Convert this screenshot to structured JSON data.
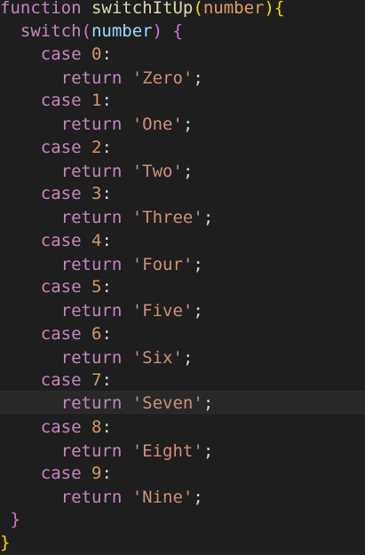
{
  "code": {
    "lines": [
      {
        "indent": "",
        "kw": "function",
        "name": "switchItUp",
        "open": "(",
        "param": "number",
        "close": ")",
        "brace": "{"
      },
      {
        "indent": "  ",
        "kw": "switch",
        "open": "(",
        "param": "number",
        "close": ")",
        "brace": " {"
      },
      {
        "indent": "    ",
        "kw": "case",
        "num": "0",
        "colon": ":"
      },
      {
        "indent": "      ",
        "kw": "return",
        "str": "'Zero'",
        "semi": ";"
      },
      {
        "indent": "    ",
        "kw": "case",
        "num": "1",
        "colon": ":"
      },
      {
        "indent": "      ",
        "kw": "return",
        "str": "'One'",
        "semi": ";"
      },
      {
        "indent": "    ",
        "kw": "case",
        "num": "2",
        "colon": ":"
      },
      {
        "indent": "      ",
        "kw": "return",
        "str": "'Two'",
        "semi": ";"
      },
      {
        "indent": "    ",
        "kw": "case",
        "num": "3",
        "colon": ":"
      },
      {
        "indent": "      ",
        "kw": "return",
        "str": "'Three'",
        "semi": ";"
      },
      {
        "indent": "    ",
        "kw": "case",
        "num": "4",
        "colon": ":"
      },
      {
        "indent": "      ",
        "kw": "return",
        "str": "'Four'",
        "semi": ";"
      },
      {
        "indent": "    ",
        "kw": "case",
        "num": "5",
        "colon": ":"
      },
      {
        "indent": "      ",
        "kw": "return",
        "str": "'Five'",
        "semi": ";"
      },
      {
        "indent": "    ",
        "kw": "case",
        "num": "6",
        "colon": ":"
      },
      {
        "indent": "      ",
        "kw": "return",
        "str": "'Six'",
        "semi": ";"
      },
      {
        "indent": "    ",
        "kw": "case",
        "num": "7",
        "colon": ":"
      },
      {
        "indent": "      ",
        "kw": "return",
        "str": "'Seven'",
        "semi": ";"
      },
      {
        "indent": "    ",
        "kw": "case",
        "num": "8",
        "colon": ":"
      },
      {
        "indent": "      ",
        "kw": "return",
        "str": "'Eight'",
        "semi": ";"
      },
      {
        "indent": "    ",
        "kw": "case",
        "num": "9",
        "colon": ":"
      },
      {
        "indent": "      ",
        "kw": "return",
        "str": "'Nine'",
        "semi": ";"
      },
      {
        "indent": " ",
        "brace": "}"
      },
      {
        "indent": "",
        "brace": "}"
      }
    ]
  },
  "colors": {
    "background": "#1e1e1e",
    "keyword": "#c586c0",
    "function_name": "#dcdcaa",
    "parameter": "#e0a060",
    "number": "#d19a66",
    "string": "#ce9178",
    "current_line": "#282828"
  }
}
